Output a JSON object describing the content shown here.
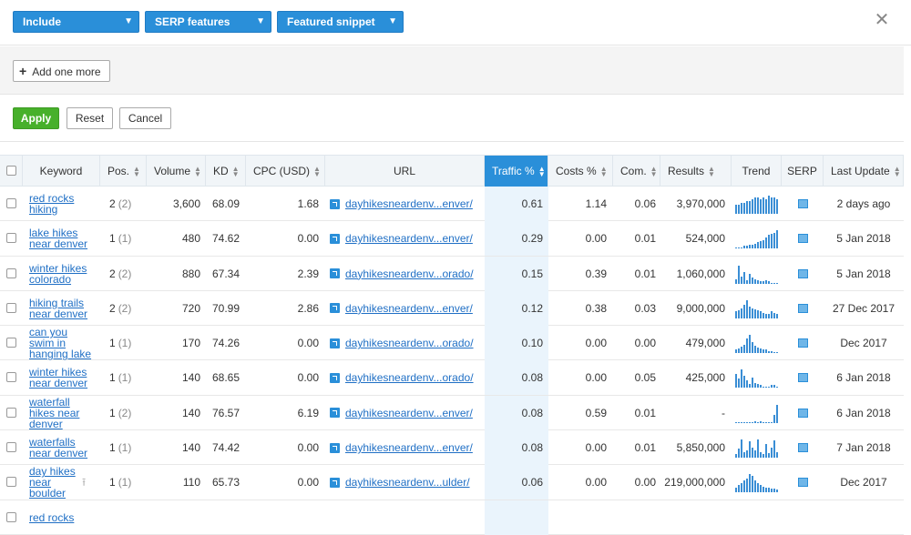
{
  "filters": {
    "selects": [
      "Include",
      "SERP features",
      "Featured snippet"
    ],
    "add_more_label": "Add one more",
    "apply_label": "Apply",
    "reset_label": "Reset",
    "cancel_label": "Cancel"
  },
  "colors": {
    "accent": "#2a8fd9",
    "apply": "#47b02b",
    "link": "#1f6fc5"
  },
  "columns": [
    "Keyword",
    "Pos.",
    "Volume",
    "KD",
    "CPC (USD)",
    "URL",
    "Traffic %",
    "Costs %",
    "Com.",
    "Results",
    "Trend",
    "SERP",
    "Last Update"
  ],
  "rows": [
    {
      "keyword": [
        "red rocks",
        "hiking"
      ],
      "pos": "2",
      "pos_sub": "(2)",
      "volume": "3,600",
      "kd": "68.09",
      "cpc": "1.68",
      "url": "dayhikesneardenv...enver/",
      "traffic": "0.61",
      "costs": "1.14",
      "com": "0.06",
      "results": "3,970,000",
      "trend": [
        5,
        5,
        6,
        6,
        7,
        7,
        8,
        9,
        9,
        8,
        9,
        8,
        10,
        9,
        9,
        8
      ],
      "last_update": "2 days ago"
    },
    {
      "keyword": [
        "lake hikes",
        "near denver"
      ],
      "pos": "1",
      "pos_sub": "(1)",
      "volume": "480",
      "kd": "74.62",
      "cpc": "0.00",
      "url": "dayhikesneardenv...enver/",
      "traffic": "0.29",
      "costs": "0.00",
      "com": "0.01",
      "results": "524,000",
      "trend": [
        1,
        1,
        1,
        2,
        2,
        3,
        3,
        4,
        5,
        6,
        7,
        9,
        11,
        12,
        13,
        15
      ],
      "last_update": "5 Jan 2018"
    },
    {
      "keyword": [
        "winter hikes",
        "colorado"
      ],
      "pos": "2",
      "pos_sub": "(2)",
      "volume": "880",
      "kd": "67.34",
      "cpc": "2.39",
      "url": "dayhikesneardenv...orado/",
      "traffic": "0.15",
      "costs": "0.39",
      "com": "0.01",
      "results": "1,060,000",
      "trend": [
        4,
        15,
        6,
        10,
        3,
        8,
        5,
        4,
        3,
        2,
        2,
        3,
        2,
        1,
        1,
        1
      ],
      "last_update": "5 Jan 2018"
    },
    {
      "keyword": [
        "hiking trails",
        "near denver"
      ],
      "pos": "2",
      "pos_sub": "(2)",
      "volume": "720",
      "kd": "70.99",
      "cpc": "2.86",
      "url": "dayhikesneardenv...enver/",
      "traffic": "0.12",
      "costs": "0.38",
      "com": "0.03",
      "results": "9,000,000",
      "trend": [
        6,
        7,
        9,
        12,
        16,
        10,
        9,
        8,
        7,
        6,
        5,
        4,
        4,
        6,
        5,
        4
      ],
      "last_update": "27 Dec 2017"
    },
    {
      "keyword": [
        "can you",
        "swim in",
        "hanging lake"
      ],
      "pos": "1",
      "pos_sub": "(1)",
      "volume": "170",
      "kd": "74.26",
      "cpc": "0.00",
      "url": "dayhikesneardenv...orado/",
      "traffic": "0.10",
      "costs": "0.00",
      "com": "0.00",
      "results": "479,000",
      "trend": [
        3,
        4,
        6,
        8,
        14,
        17,
        10,
        7,
        5,
        4,
        3,
        3,
        2,
        2,
        1,
        1
      ],
      "last_update": "Dec 2017"
    },
    {
      "keyword": [
        "winter hikes",
        "near denver"
      ],
      "pos": "1",
      "pos_sub": "(1)",
      "volume": "140",
      "kd": "68.65",
      "cpc": "0.00",
      "url": "dayhikesneardenv...orado/",
      "traffic": "0.08",
      "costs": "0.00",
      "com": "0.05",
      "results": "425,000",
      "trend": [
        12,
        8,
        16,
        10,
        6,
        3,
        9,
        4,
        3,
        2,
        1,
        1,
        1,
        2,
        2,
        1
      ],
      "last_update": "6 Jan 2018"
    },
    {
      "keyword": [
        "waterfall",
        "hikes near",
        "denver"
      ],
      "pos": "1",
      "pos_sub": "(2)",
      "volume": "140",
      "kd": "76.57",
      "cpc": "6.19",
      "url": "dayhikesneardenv...enver/",
      "traffic": "0.08",
      "costs": "0.59",
      "com": "0.01",
      "results": "-",
      "trend": [
        0,
        0,
        0,
        1,
        0,
        0,
        0,
        2,
        0,
        2,
        0,
        0,
        0,
        0,
        8,
        18
      ],
      "last_update": "6 Jan 2018"
    },
    {
      "keyword": [
        "waterfalls",
        "near denver"
      ],
      "pos": "1",
      "pos_sub": "(1)",
      "volume": "140",
      "kd": "74.42",
      "cpc": "0.00",
      "url": "dayhikesneardenv...enver/",
      "traffic": "0.08",
      "costs": "0.00",
      "com": "0.01",
      "results": "5,850,000",
      "trend": [
        3,
        8,
        16,
        5,
        6,
        14,
        9,
        6,
        16,
        5,
        3,
        12,
        4,
        9,
        15,
        5
      ],
      "last_update": "7 Jan 2018"
    },
    {
      "keyword": [
        "day hikes",
        "near",
        "boulder"
      ],
      "pos": "1",
      "pos_sub": "(1)",
      "volume": "110",
      "kd": "65.73",
      "cpc": "0.00",
      "url": "dayhikesneardenv...ulder/",
      "traffic": "0.06",
      "costs": "0.00",
      "com": "0.00",
      "results": "219,000,000",
      "trend": [
        4,
        6,
        8,
        10,
        12,
        16,
        14,
        10,
        8,
        6,
        5,
        4,
        4,
        3,
        3,
        2
      ],
      "last_update": "Dec 2017"
    },
    {
      "keyword": [
        "red rocks"
      ],
      "pos": "",
      "pos_sub": "",
      "volume": "",
      "kd": "",
      "cpc": "",
      "url": "",
      "traffic": "",
      "costs": "",
      "com": "",
      "results": "",
      "trend": [],
      "last_update": ""
    }
  ]
}
